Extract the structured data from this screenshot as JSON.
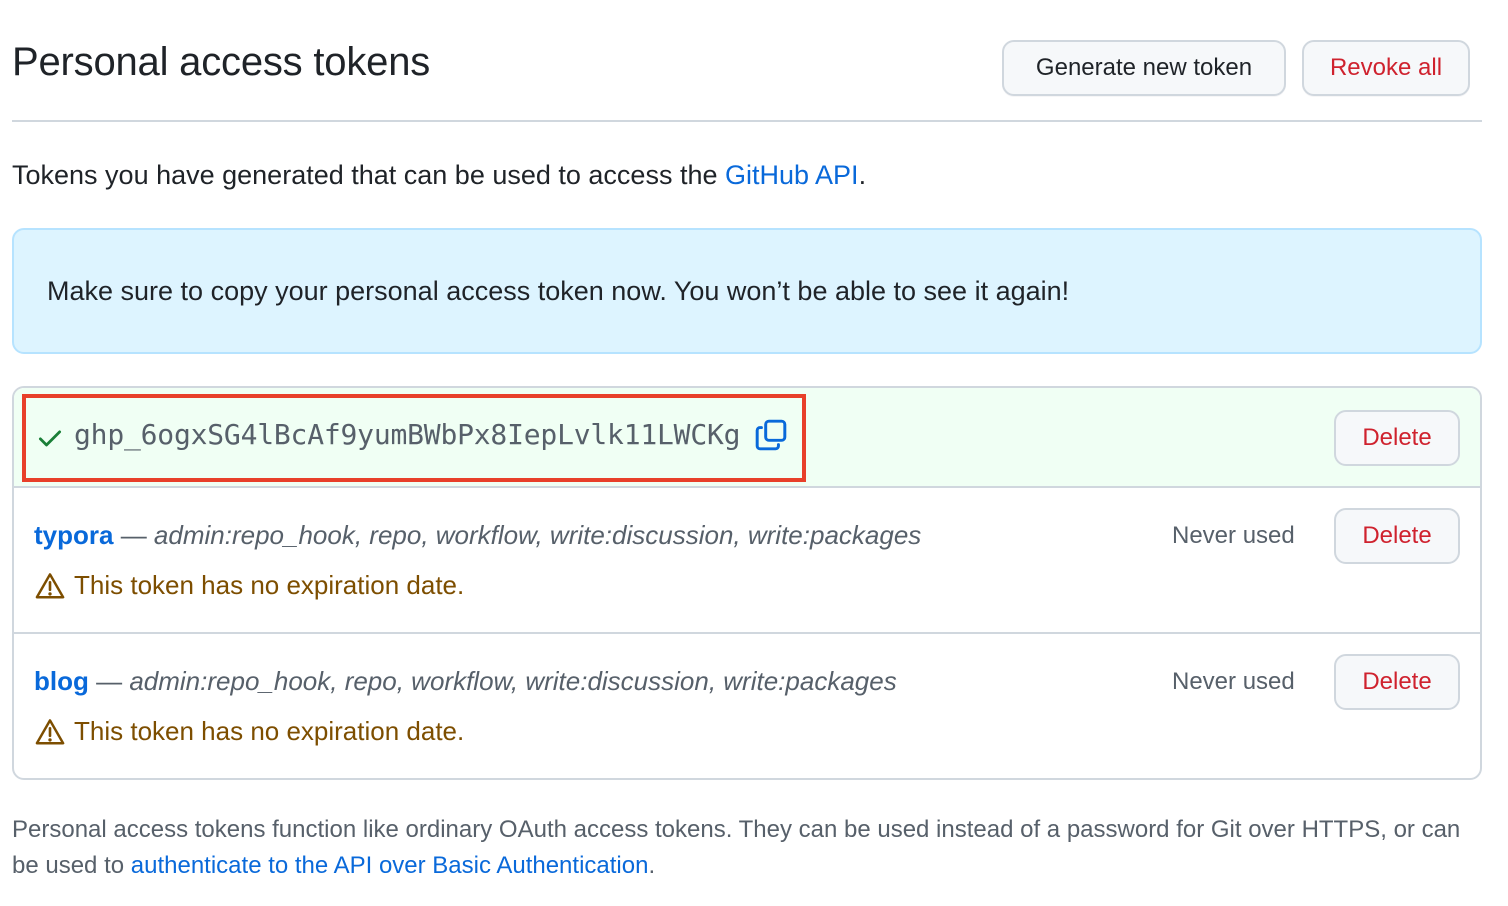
{
  "header": {
    "title": "Personal access tokens",
    "generate_label": "Generate new token",
    "revoke_label": "Revoke all"
  },
  "intro": {
    "text": "Tokens you have generated that can be used to access the ",
    "link": "GitHub API",
    "suffix": "."
  },
  "flash": {
    "message": "Make sure to copy your personal access token now. You won’t be able to see it again!"
  },
  "new_token": {
    "value": "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",
    "delete_label": "Delete"
  },
  "tokens": [
    {
      "name": "typora",
      "separator": " — ",
      "scopes": "admin:repo_hook, repo, workflow, write:discussion, write:packages",
      "last_used": "Never used",
      "warning": "This token has no expiration date.",
      "delete_label": "Delete"
    },
    {
      "name": "blog",
      "separator": " — ",
      "scopes": "admin:repo_hook, repo, workflow, write:discussion, write:packages",
      "last_used": "Never used",
      "warning": "This token has no expiration date.",
      "delete_label": "Delete"
    }
  ],
  "footer": {
    "text": "Personal access tokens function like ordinary OAuth access tokens. They can be used instead of a password for Git over HTTPS, or can be used to ",
    "link": "authenticate to the API over Basic Authentication",
    "suffix": "."
  },
  "icons": {
    "check": "check-icon",
    "copy": "copy-icon",
    "warning": "alert-triangle-icon"
  },
  "colors": {
    "link": "#0969da",
    "danger": "#cf222e",
    "success": "#1a7f37",
    "warning_text": "#7d4e00",
    "flash_bg": "#ddf4ff",
    "new_token_bg": "#f0fff4",
    "highlight": "#e8402a"
  }
}
